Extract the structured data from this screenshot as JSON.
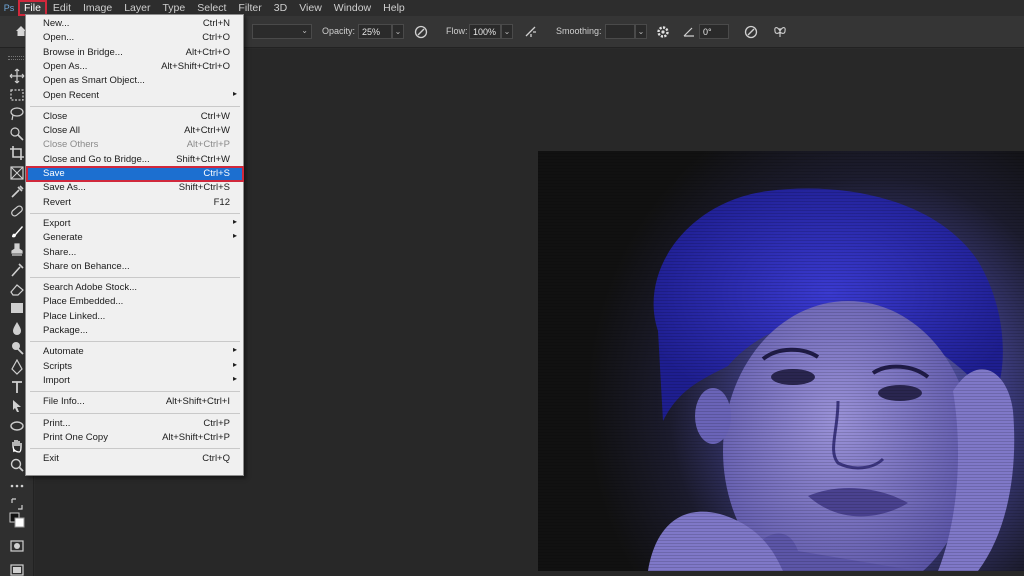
{
  "menubar": {
    "items": [
      "File",
      "Edit",
      "Image",
      "Layer",
      "Type",
      "Select",
      "Filter",
      "3D",
      "View",
      "Window",
      "Help"
    ]
  },
  "options": {
    "opacity_label": "Opacity:",
    "opacity_value": "25%",
    "flow_label": "Flow:",
    "flow_value": "100%",
    "smoothing_label": "Smoothing:",
    "smoothing_value": "",
    "angle_value": "0°"
  },
  "file_menu": {
    "groups": [
      [
        {
          "label": "New...",
          "shortcut": "Ctrl+N"
        },
        {
          "label": "Open...",
          "shortcut": "Ctrl+O"
        },
        {
          "label": "Browse in Bridge...",
          "shortcut": "Alt+Ctrl+O"
        },
        {
          "label": "Open As...",
          "shortcut": "Alt+Shift+Ctrl+O"
        },
        {
          "label": "Open as Smart Object...",
          "shortcut": ""
        },
        {
          "label": "Open Recent",
          "shortcut": "",
          "submenu": true
        }
      ],
      [
        {
          "label": "Close",
          "shortcut": "Ctrl+W"
        },
        {
          "label": "Close All",
          "shortcut": "Alt+Ctrl+W"
        },
        {
          "label": "Close Others",
          "shortcut": "Alt+Ctrl+P",
          "disabled": true
        },
        {
          "label": "Close and Go to Bridge...",
          "shortcut": "Shift+Ctrl+W"
        },
        {
          "label": "Save",
          "shortcut": "Ctrl+S",
          "highlighted": true
        },
        {
          "label": "Save As...",
          "shortcut": "Shift+Ctrl+S"
        },
        {
          "label": "Revert",
          "shortcut": "F12"
        }
      ],
      [
        {
          "label": "Export",
          "shortcut": "",
          "submenu": true
        },
        {
          "label": "Generate",
          "shortcut": "",
          "submenu": true
        },
        {
          "label": "Share...",
          "shortcut": ""
        },
        {
          "label": "Share on Behance...",
          "shortcut": ""
        }
      ],
      [
        {
          "label": "Search Adobe Stock...",
          "shortcut": ""
        },
        {
          "label": "Place Embedded...",
          "shortcut": ""
        },
        {
          "label": "Place Linked...",
          "shortcut": ""
        },
        {
          "label": "Package...",
          "shortcut": ""
        }
      ],
      [
        {
          "label": "Automate",
          "shortcut": "",
          "submenu": true
        },
        {
          "label": "Scripts",
          "shortcut": "",
          "submenu": true
        },
        {
          "label": "Import",
          "shortcut": "",
          "submenu": true
        }
      ],
      [
        {
          "label": "File Info...",
          "shortcut": "Alt+Shift+Ctrl+I"
        }
      ],
      [
        {
          "label": "Print...",
          "shortcut": "Ctrl+P"
        },
        {
          "label": "Print One Copy",
          "shortcut": "Alt+Shift+Ctrl+P"
        }
      ],
      [
        {
          "label": "Exit",
          "shortcut": "Ctrl+Q"
        }
      ]
    ]
  },
  "colors": {
    "highlight": "#1c6fd0",
    "annotation_red": "#d0283c",
    "canvas_tint": "#5a5ab0"
  },
  "tools": [
    "move-icon",
    "marquee-icon",
    "lasso-icon",
    "quick-select-icon",
    "crop-icon",
    "frame-icon",
    "eyedropper-icon",
    "healing-icon",
    "brush-icon",
    "stamp-icon",
    "history-brush-icon",
    "eraser-icon",
    "gradient-icon",
    "blur-icon",
    "dodge-icon",
    "pen-icon",
    "type-icon",
    "path-select-icon",
    "shape-icon",
    "hand-icon",
    "zoom-icon",
    "more-icon",
    "swap-colors-icon",
    "color-swatch-icon",
    "quick-mask-icon",
    "screen-mode-icon"
  ]
}
